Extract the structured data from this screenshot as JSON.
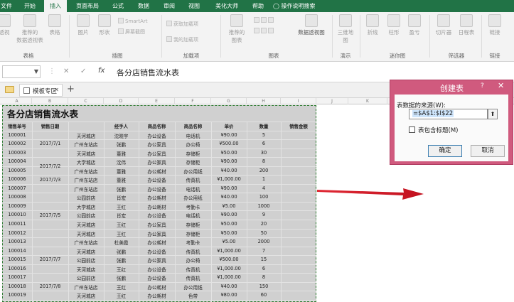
{
  "ribbon_tabs": [
    {
      "label": "文件",
      "active": false
    },
    {
      "label": "开始",
      "active": false
    },
    {
      "label": "插入",
      "active": true
    },
    {
      "label": "页面布局",
      "active": false
    },
    {
      "label": "公式",
      "active": false
    },
    {
      "label": "数据",
      "active": false
    },
    {
      "label": "审阅",
      "active": false
    },
    {
      "label": "视图",
      "active": false
    },
    {
      "label": "美化大师",
      "active": false
    },
    {
      "label": "帮助",
      "active": false
    }
  ],
  "tell_me": {
    "icon": "lightbulb-icon",
    "label": "操作说明搜索"
  },
  "ribbon": {
    "buttons": {
      "pivot": "透视",
      "recommended_pivot": "推荐的\n数据透视表",
      "table": "表格",
      "pictures": "图片",
      "shapes": "形状",
      "smartart": "SmartArt",
      "screenshot": "屏幕截图",
      "get_addins": "获取加载项",
      "my_addins": "我的加载项",
      "recommended_charts": "推荐的\n图表",
      "pivot_chart": "数据透视图",
      "map3d": "三维地\n图",
      "line": "折线",
      "column": "柱形",
      "winloss": "盈亏",
      "slicer": "切片器",
      "timeline": "日程表",
      "link": "链接"
    },
    "groups": {
      "tables": "表格",
      "illustrations": "插图",
      "addins": "加载项",
      "charts": "图表",
      "tours": "演示",
      "sparklines": "迷你图",
      "filters": "筛选器",
      "links": "链接"
    }
  },
  "formula_bar": {
    "name_box": "",
    "cancel": "✕",
    "enter": "✓",
    "fx": "fx",
    "value": "各分店销售流水表"
  },
  "sheet_tab": {
    "label": "模板专区",
    "close": "✕",
    "add": "+"
  },
  "columns": [
    "A",
    "B",
    "C",
    "D",
    "E",
    "F",
    "G",
    "H",
    "I",
    "J",
    "K",
    "L",
    "M",
    "N",
    "O"
  ],
  "sheet": {
    "title": "各分店销售流水表",
    "headers": [
      "销售单号",
      "销售日期",
      "",
      "经手人",
      "商品名称",
      "商品名称",
      "单价",
      "数量",
      "销售金额"
    ],
    "dates": [
      {
        "label": "2017/7/1"
      },
      {
        "label": "2017/7/2"
      },
      {
        "label": "2017/7/3"
      },
      {
        "label": "2017/7/5"
      },
      {
        "label": "2017/7/7"
      },
      {
        "label": "2017/7/8"
      }
    ],
    "rows": [
      [
        "100001",
        "天河城店",
        "沈晓宇",
        "办公设备",
        "电话机",
        "¥90.00",
        "5"
      ],
      [
        "100002",
        "广州东站店",
        "张鹏",
        "办公家具",
        "办公椅",
        "¥500.00",
        "6"
      ],
      [
        "100003",
        "天河城店",
        "董雅",
        "办公家具",
        "存储柜",
        "¥50.00",
        "30"
      ],
      [
        "100004",
        "大学城店",
        "沈伟",
        "办公家具",
        "存储柜",
        "¥90.00",
        "8"
      ],
      [
        "100005",
        "广州东站店",
        "董雅",
        "办公耗材",
        "办公用纸",
        "¥40.00",
        "200"
      ],
      [
        "100006",
        "广州东站店",
        "董雅",
        "办公设备",
        "传真机",
        "¥1,000.00",
        "1"
      ],
      [
        "100007",
        "广州东站店",
        "张鹏",
        "办公设备",
        "电话机",
        "¥90.00",
        "4"
      ],
      [
        "100008",
        "公园前店",
        "肖宏",
        "办公耗材",
        "办公用纸",
        "¥40.00",
        "100"
      ],
      [
        "100009",
        "大学城店",
        "王红",
        "办公耗材",
        "考勤卡",
        "¥5.00",
        "1000"
      ],
      [
        "100010",
        "公园前店",
        "肖宏",
        "办公设备",
        "电话机",
        "¥90.00",
        "9"
      ],
      [
        "100011",
        "天河城店",
        "王红",
        "办公家具",
        "存储柜",
        "¥50.00",
        "20"
      ],
      [
        "100012",
        "天河城店",
        "王红",
        "办公家具",
        "存储柜",
        "¥50.00",
        "50"
      ],
      [
        "100013",
        "广州东站店",
        "杜美霞",
        "办公耗材",
        "考勤卡",
        "¥5.00",
        "2000"
      ],
      [
        "100014",
        "天河城店",
        "张鹏",
        "办公设备",
        "传真机",
        "¥1,000.00",
        "7"
      ],
      [
        "100015",
        "公园前店",
        "张鹏",
        "办公家具",
        "办公椅",
        "¥500.00",
        "15"
      ],
      [
        "100016",
        "天河城店",
        "王红",
        "办公设备",
        "传真机",
        "¥1,000.00",
        "6"
      ],
      [
        "100017",
        "公园前店",
        "张鹏",
        "办公设备",
        "传真机",
        "¥1,000.00",
        "8"
      ],
      [
        "100018",
        "广州东站店",
        "王红",
        "办公耗材",
        "办公用纸",
        "¥40.00",
        "150"
      ],
      [
        "100019",
        "天河城店",
        "王红",
        "办公耗材",
        "色带",
        "¥80.00",
        "60"
      ]
    ]
  },
  "dialog": {
    "title": "创建表",
    "help": "?",
    "close": "✕",
    "source_label": "表数据的来源(W):",
    "range_value": "=$A$1:$I$22",
    "checkbox_label": "表包含标题(M)",
    "checkbox_checked": false,
    "ok": "确定",
    "cancel": "取消"
  },
  "colors": {
    "ribbon_green": "#217346",
    "dialog_pink": "#d05a7e",
    "arrow_red": "#d81e2b",
    "selection_border": "#2e7d32"
  }
}
